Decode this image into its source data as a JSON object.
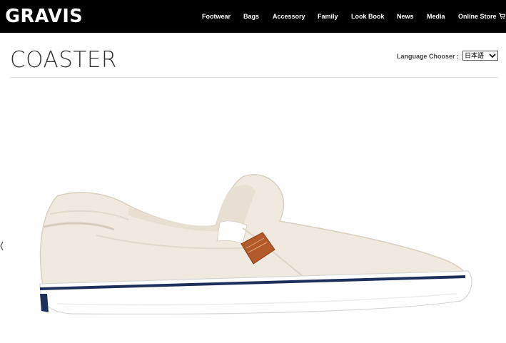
{
  "header": {
    "logo": "GRAVIS",
    "nav": [
      {
        "label": "Footwear"
      },
      {
        "label": "Bags"
      },
      {
        "label": "Accessory"
      },
      {
        "label": "Family"
      },
      {
        "label": "Look Book"
      },
      {
        "label": "News"
      },
      {
        "label": "Media"
      },
      {
        "label": "Online Store"
      }
    ],
    "cart_icon": "cart-icon"
  },
  "page": {
    "title": "COASTER",
    "language_label": "Language Chooser :",
    "language_selected": "日本語"
  },
  "product": {
    "image_icon": "slip-on-shoe-image"
  },
  "colors": {
    "topbar": "#000000",
    "text": "#333333",
    "shoe_canvas": "#efe9df",
    "stripe": "#1e2f5c",
    "tag": "#b35a2a"
  }
}
